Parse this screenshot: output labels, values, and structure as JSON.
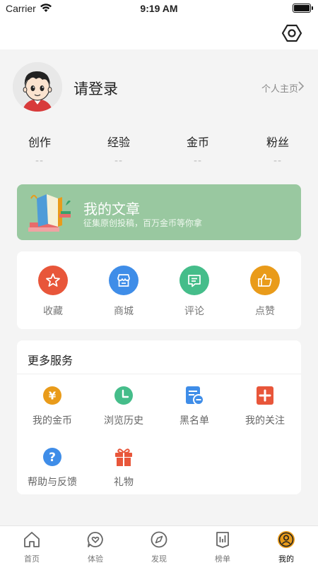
{
  "status_bar": {
    "carrier": "Carrier",
    "time": "9:19 AM"
  },
  "profile": {
    "login_text": "请登录",
    "homepage_link": "个人主页"
  },
  "stats": [
    {
      "label": "创作",
      "value": "--"
    },
    {
      "label": "经验",
      "value": "--"
    },
    {
      "label": "金币",
      "value": "--"
    },
    {
      "label": "粉丝",
      "value": "--"
    }
  ],
  "article_banner": {
    "title": "我的文章",
    "subtitle": "征集原创投稿，百万金币等你拿",
    "color": "#99c8a0"
  },
  "quick_actions": [
    {
      "label": "收藏",
      "icon": "star-icon",
      "color": "#e8563a"
    },
    {
      "label": "商城",
      "icon": "shop-icon",
      "color": "#3f8de8"
    },
    {
      "label": "评论",
      "icon": "comment-icon",
      "color": "#45bd8a"
    },
    {
      "label": "点赞",
      "icon": "thumbs-up-icon",
      "color": "#e99b1a"
    }
  ],
  "services": {
    "title": "更多服务",
    "items": [
      {
        "label": "我的金币",
        "icon": "coin-icon",
        "color": "#e99b1a"
      },
      {
        "label": "浏览历史",
        "icon": "clock-icon",
        "color": "#45bd8a"
      },
      {
        "label": "黑名单",
        "icon": "blacklist-icon",
        "color": "#3f8de8"
      },
      {
        "label": "我的关注",
        "icon": "follow-plus-icon",
        "color": "#e8563a"
      },
      {
        "label": "帮助与反馈",
        "icon": "help-icon",
        "color": "#3f8de8"
      },
      {
        "label": "礼物",
        "icon": "gift-icon",
        "color": "#e8563a"
      }
    ]
  },
  "tab_bar": {
    "tabs": [
      {
        "label": "首页",
        "icon": "home-icon"
      },
      {
        "label": "体验",
        "icon": "heart-bubble-icon"
      },
      {
        "label": "发现",
        "icon": "compass-icon"
      },
      {
        "label": "榜单",
        "icon": "ranking-icon"
      },
      {
        "label": "我的",
        "icon": "user-icon",
        "active": true
      }
    ],
    "active_color": "#e99b1a"
  }
}
